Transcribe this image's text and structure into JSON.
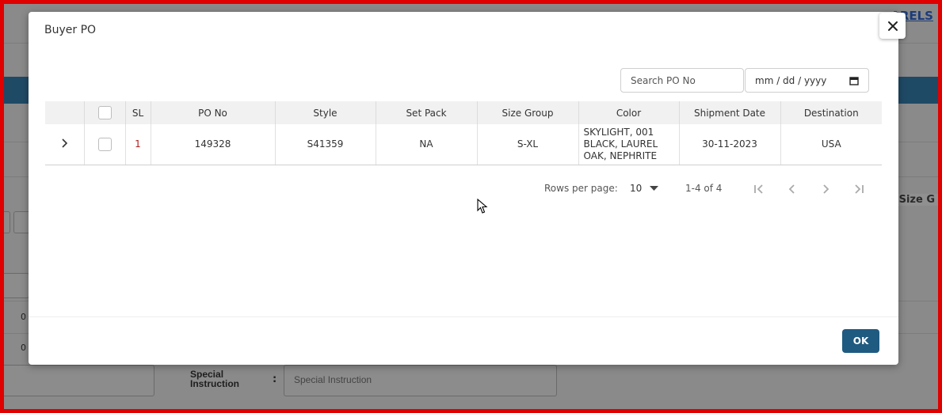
{
  "background": {
    "brand_fragment": "ARELS",
    "column_header_fragment": "Size G",
    "special_instruction_label": "Special Instruction",
    "special_instruction_placeholder": "Special Instruction",
    "row_values": [
      "0",
      "0"
    ]
  },
  "modal": {
    "title": "Buyer PO",
    "search": {
      "placeholder": "Search PO No",
      "value": ""
    },
    "date": {
      "placeholder": "mm / dd / yyyy"
    },
    "table": {
      "columns": [
        "SL",
        "PO No",
        "Style",
        "Set Pack",
        "Size Group",
        "Color",
        "Shipment Date",
        "Destination"
      ],
      "rows": [
        {
          "sl": "1",
          "po_no": "149328",
          "style": "S41359",
          "set_pack": "NA",
          "size_group": "S-XL",
          "color": "SKYLIGHT, 001 BLACK, LAUREL OAK, NEPHRITE",
          "shipment_date": "30-11-2023",
          "destination": "USA"
        }
      ]
    },
    "pagination": {
      "rows_per_page_label": "Rows per page:",
      "rows_per_page_value": "10",
      "range": "1-4 of 4"
    },
    "ok_label": "OK"
  },
  "icons": {
    "close": "close-icon",
    "expand": "chevron-right-icon",
    "calendar": "calendar-icon",
    "dropdown": "caret-down-icon",
    "first": "first-page-icon",
    "prev": "chevron-left-icon",
    "next": "chevron-right-icon",
    "last": "last-page-icon"
  },
  "colors": {
    "primary": "#1f5a80",
    "frame": "#e00000",
    "sl_text": "#b02020"
  }
}
